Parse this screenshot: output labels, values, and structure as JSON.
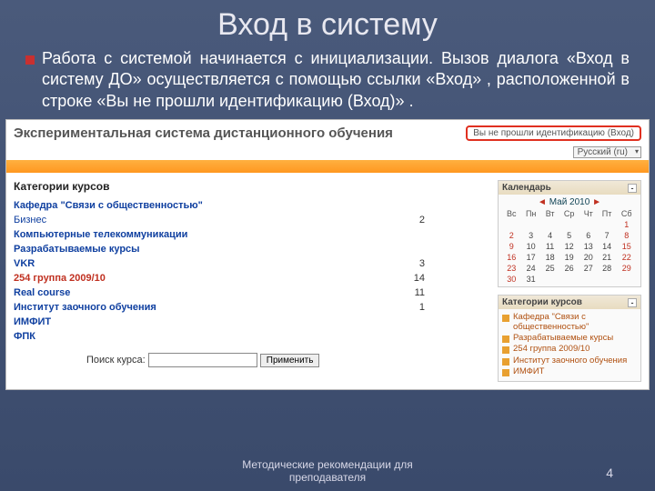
{
  "slide": {
    "title": "Вход в систему",
    "paragraph": "Работа с системой начинается с инициализации. Вызов диалога «Вход в систему ДО» осуществляется с помощью ссылки «Вход» , расположенной в строке «Вы не прошли идентификацию (Вход)» .",
    "footer": "Методические рекомендации для преподавателя",
    "page": "4"
  },
  "shot": {
    "title": "Экспериментальная система дистанционного обучения",
    "login_text": "Вы не прошли идентификацию (Вход)",
    "lang": "Русский (ru)",
    "categories_header": "Категории курсов",
    "courses": [
      {
        "label": "Кафедра \"Связи с общественностью\"",
        "count": "",
        "bold": true
      },
      {
        "label": "Бизнес",
        "count": "2",
        "bold": false
      },
      {
        "label": "Компьютерные телекоммуникации",
        "count": "",
        "bold": true
      },
      {
        "label": "Разрабатываемые курсы",
        "count": "",
        "bold": true
      },
      {
        "label": "VKR",
        "count": "3",
        "bold": true
      },
      {
        "label": "254 группа 2009/10",
        "count": "14",
        "red": true
      },
      {
        "label": "Real course",
        "count": "11",
        "bold": true
      },
      {
        "label": "Институт заочного обучения",
        "count": "1",
        "bold": true
      },
      {
        "label": "ИМФИТ",
        "count": "",
        "bold": true
      },
      {
        "label": "ФПК",
        "count": "",
        "bold": true
      }
    ],
    "search_label": "Поиск курса:",
    "search_btn": "Применить",
    "calendar": {
      "header": "Календарь",
      "month": "Май 2010",
      "days": [
        "Вс",
        "Пн",
        "Вт",
        "Ср",
        "Чт",
        "Пт",
        "Сб"
      ],
      "weeks": [
        [
          "",
          "",
          "",
          "",
          "",
          "",
          "1"
        ],
        [
          "2",
          "3",
          "4",
          "5",
          "6",
          "7",
          "8"
        ],
        [
          "9",
          "10",
          "11",
          "12",
          "13",
          "14",
          "15"
        ],
        [
          "16",
          "17",
          "18",
          "19",
          "20",
          "21",
          "22"
        ],
        [
          "23",
          "24",
          "25",
          "26",
          "27",
          "28",
          "29"
        ],
        [
          "30",
          "31",
          "",
          "",
          "",
          "",
          ""
        ]
      ]
    },
    "sidecat": {
      "header": "Категории курсов",
      "items": [
        "Кафедра \"Связи с общественностью\"",
        "Разрабатываемые курсы",
        "254 группа 2009/10",
        "Институт заочного обучения",
        "ИМФИТ"
      ]
    }
  }
}
